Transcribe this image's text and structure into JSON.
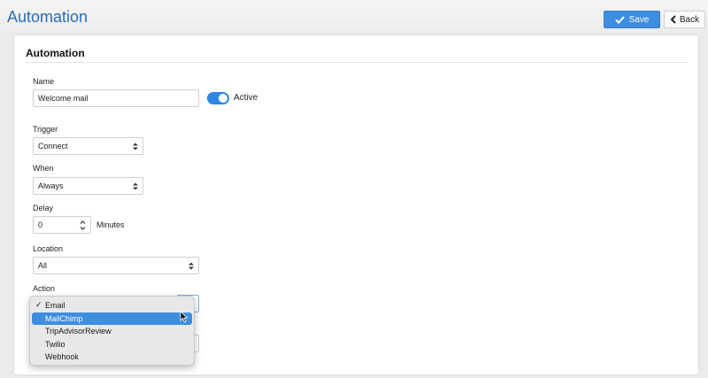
{
  "header": {
    "title": "Automation",
    "save_label": "Save",
    "back_label": "Back",
    "accent_color": "#3d8ee0"
  },
  "card": {
    "title": "Automation"
  },
  "form": {
    "name": {
      "label": "Name",
      "value": "Welcome mail"
    },
    "active": {
      "label": "Active",
      "on": true
    },
    "trigger": {
      "label": "Trigger",
      "value": "Connect"
    },
    "when": {
      "label": "When",
      "value": "Always"
    },
    "delay": {
      "label": "Delay",
      "value": "0",
      "unit": "Minutes"
    },
    "location": {
      "label": "Location",
      "value": "All"
    },
    "action": {
      "label": "Action",
      "selected": "Email",
      "highlighted": "MailChimp",
      "options": [
        "Email",
        "MailChimp",
        "TripAdvisorReview",
        "Twilio",
        "Webhook"
      ]
    }
  },
  "icons": {
    "save": "check-icon",
    "back": "chevron-left-icon",
    "select_arrows": "updown-arrows-icon",
    "cursor": "mouse-pointer-icon"
  }
}
